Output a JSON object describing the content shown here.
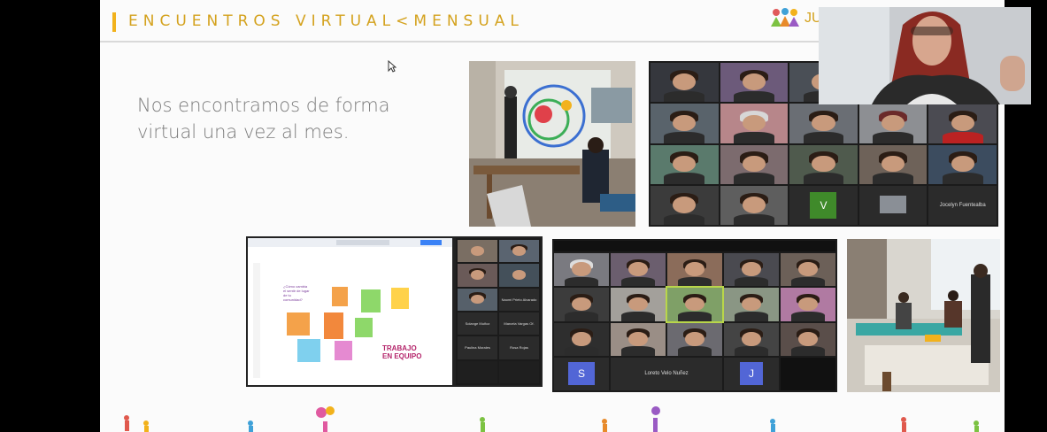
{
  "slide": {
    "title_part1": "ENCUENTROS VIRTUAL",
    "title_sep": "<",
    "title_part2": "MENSUAL",
    "logo_text": "JU",
    "subtitle": "Nos encontramos de forma virtual una vez al mes."
  },
  "grid_top": {
    "avatar_label": "V",
    "name_label": "Jocelyn Fuentealba"
  },
  "whiteboard": {
    "board_title": "TRABAJO EN EQUIPO",
    "question": "¿Cómo cambia el sentir de lugar de tu comunidad?",
    "participants": [
      "Naomi Prieto Alvarado",
      "Solange Muñoz",
      "Marcela Vargas Of.",
      "Paulina Morales",
      "Rosa Rojas"
    ]
  },
  "grid_bottom": {
    "avatar_s": "S",
    "avatar_j": "J",
    "name_label": "Loreto Velo Nuñez"
  },
  "colors": {
    "accent": "#f2b21c",
    "title": "#d4a21e",
    "subtitle": "#7b7b7b",
    "avatar_green": "#3f8a2a",
    "avatar_blue": "#5266d6",
    "wb_magenta": "#b4246a"
  },
  "icons": [
    "mouse-cursor-icon",
    "confetti-figures"
  ]
}
